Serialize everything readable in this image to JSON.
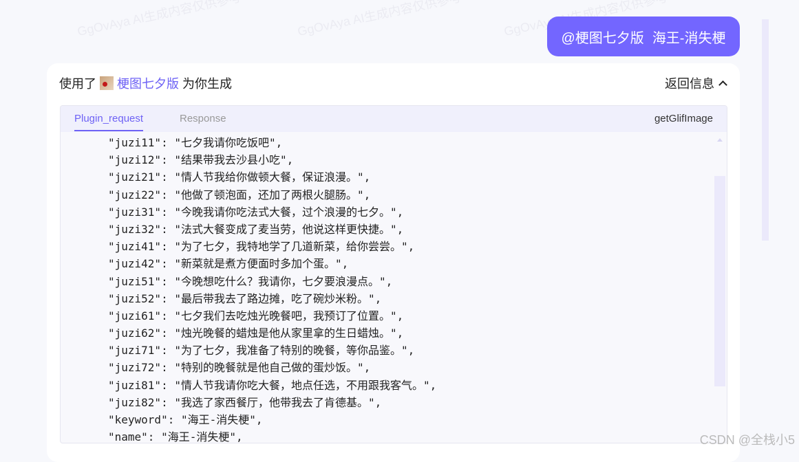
{
  "watermark": "GgOvAya AI生成内容仅供参考",
  "user_message": {
    "mention": "@梗图七夕版",
    "text": "海王-消失梗"
  },
  "response_header": {
    "prefix": "使用了",
    "plugin_name": "梗图七夕版",
    "suffix": "为你生成",
    "toggle_label": "返回信息"
  },
  "plugin_panel": {
    "tabs": [
      {
        "label": "Plugin_request"
      },
      {
        "label": "Response"
      }
    ],
    "function_name": "getGlifImage",
    "code_lines": [
      "\"juzi11\": \"七夕我请你吃饭吧\",",
      "\"juzi12\": \"结果带我去沙县小吃\",",
      "\"juzi21\": \"情人节我给你做顿大餐，保证浪漫。\",",
      "\"juzi22\": \"他做了顿泡面，还加了两根火腿肠。\",",
      "\"juzi31\": \"今晚我请你吃法式大餐，过个浪漫的七夕。\",",
      "\"juzi32\": \"法式大餐变成了麦当劳，他说这样更快捷。\",",
      "\"juzi41\": \"为了七夕，我特地学了几道新菜，给你尝尝。\",",
      "\"juzi42\": \"新菜就是煮方便面时多加个蛋。\",",
      "\"juzi51\": \"今晚想吃什么？我请你，七夕要浪漫点。\",",
      "\"juzi52\": \"最后带我去了路边摊，吃了碗炒米粉。\",",
      "\"juzi61\": \"七夕我们去吃烛光晚餐吧，我预订了位置。\",",
      "\"juzi62\": \"烛光晚餐的蜡烛是他从家里拿的生日蜡烛。\",",
      "\"juzi71\": \"为了七夕，我准备了特别的晚餐，等你品鉴。\",",
      "\"juzi72\": \"特别的晚餐就是他自己做的蛋炒饭。\",",
      "\"juzi81\": \"情人节我请你吃大餐，地点任选，不用跟我客气。\",",
      "\"juzi82\": \"我选了家西餐厅，他带我去了肯德基。\",",
      "\"keyword\": \"海王-消失梗\",",
      "\"name\": \"海王-消失梗\","
    ]
  },
  "footer": {
    "credit": "CSDN @全栈小5"
  },
  "colors": {
    "accent": "#7366ff",
    "link": "#6e62f5"
  }
}
